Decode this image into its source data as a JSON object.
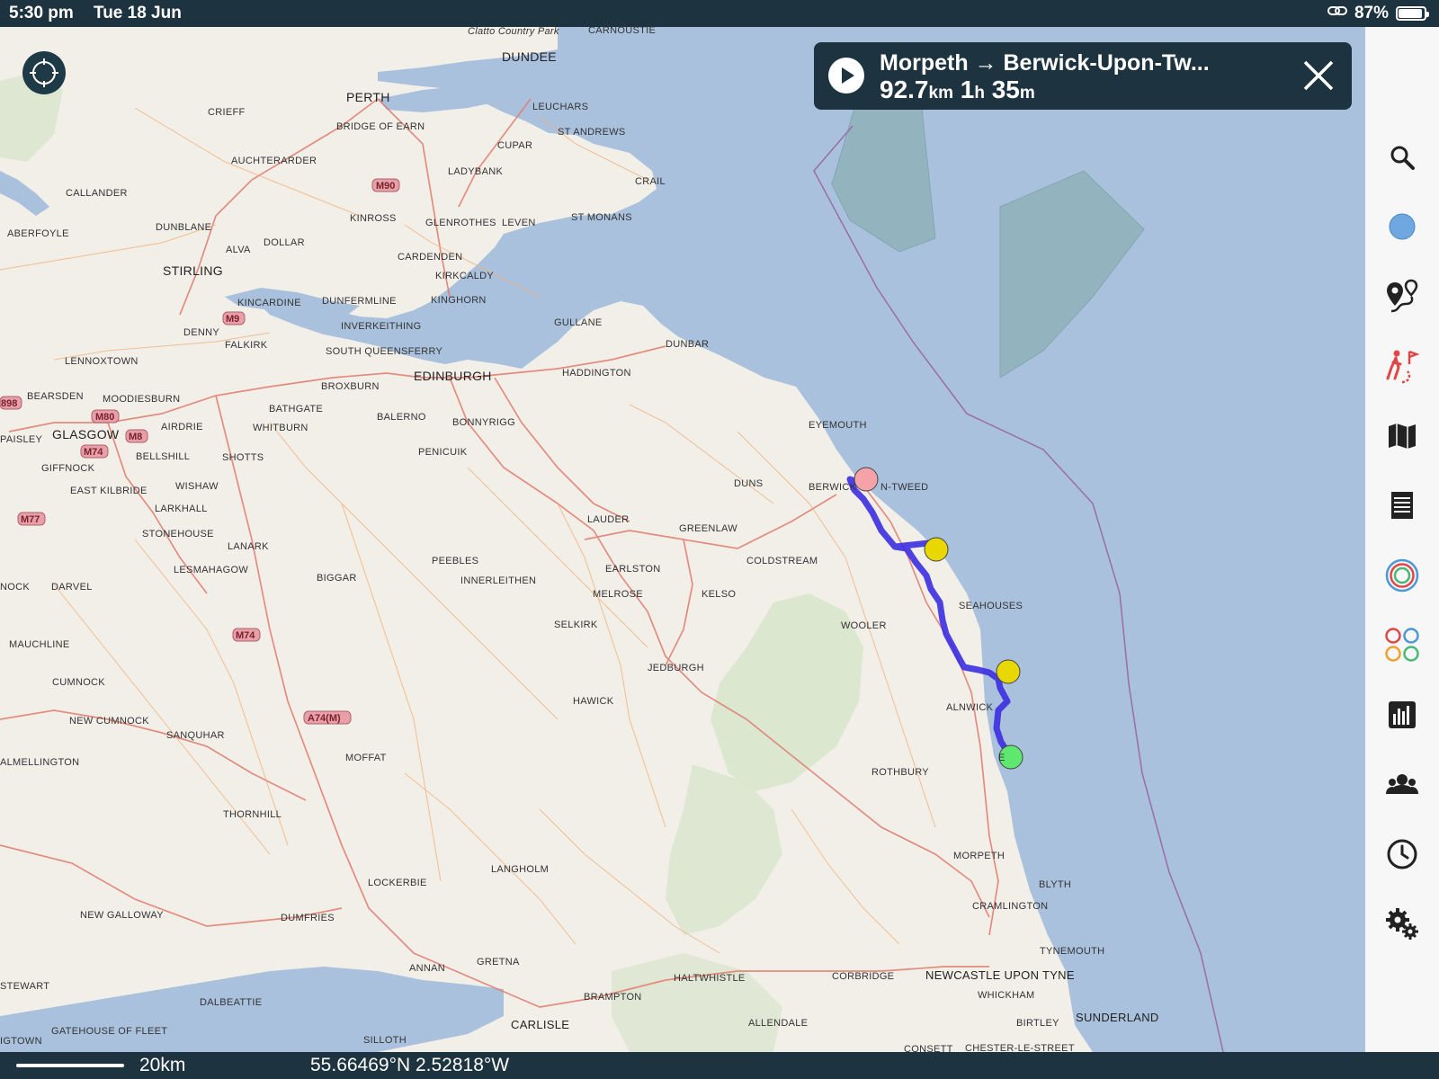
{
  "status_bar": {
    "time": "5:30 pm",
    "date": "Tue 18 Jun",
    "battery": "87%",
    "battery_level": 0.87
  },
  "route": {
    "title": "Morpeth → Berwick-Upon-Tw...",
    "distance_value": "92.7",
    "distance_unit": "km",
    "hours_value": "1",
    "hours_unit": "h",
    "minutes_value": "35",
    "minutes_unit": "m"
  },
  "map": {
    "places": [
      "DUNDEE",
      "PERTH",
      "CRIEFF",
      "BRIDGE OF EARN",
      "LEUCHARS",
      "ST ANDREWS",
      "CUPAR",
      "AUCHTERARDER",
      "LADYBANK",
      "CRAIL",
      "CALLANDER",
      "DUNBLANE",
      "KINROSS",
      "GLENROTHES",
      "LEVEN",
      "ST MONANS",
      "ABERFOYLE",
      "ALVA",
      "DOLLAR",
      "CARDENDEN",
      "STIRLING",
      "KIRKCALDY",
      "KINCARDINE",
      "DUNFERMLINE",
      "KINGHORN",
      "DENNY",
      "INVERKEITHING",
      "GULLANE",
      "FALKIRK",
      "DUNBAR",
      "LENNOXTOWN",
      "SOUTH QUEENSFERRY",
      "HADDINGTON",
      "BROXBURN",
      "EDINBURGH",
      "BEARSDEN",
      "MOODIESBURN",
      "BATHGATE",
      "GLASGOW",
      "AIRDRIE",
      "WHITBURN",
      "BALERNO",
      "BONNYRIGG",
      "PAISLEY",
      "BELLSHILL",
      "SHOTTS",
      "PENICUIK",
      "EYEMOUTH",
      "GIFFNOCK",
      "WISHAW",
      "EAST KILBRIDE",
      "DUNS",
      "LARKHALL",
      "LAUDER",
      "GREENLAW",
      "STONEHOUSE",
      "LANARK",
      "PEEBLES",
      "COLDSTREAM",
      "LESMAHAGOW",
      "INNERLEITHEN",
      "EARLSTON",
      "NOCK",
      "DARVEL",
      "BIGGAR",
      "MELROSE",
      "KELSO",
      "SEAHOUSES",
      "SELKIRK",
      "WOOLER",
      "MAUCHLINE",
      "JEDBURGH",
      "CUMNOCK",
      "HAWICK",
      "ALNWICK",
      "NEW CUMNOCK",
      "SANQUHAR",
      "MOFFAT",
      "ALMELLINGTON",
      "ROTHBURY",
      "THORNHILL",
      "MORPETH",
      "LANGHOLM",
      "LOCKERBIE",
      "BLYTH",
      "CRAMLINGTON",
      "NEW GALLOWAY",
      "DUMFRIES",
      "TYNEMOUTH",
      "STEWART",
      "ANNAN",
      "GRETNA",
      "HALTWHISTLE",
      "CORBRIDGE",
      "NEWCASTLE UPON TYNE",
      "DALBEATTIE",
      "BRAMPTON",
      "WHICKHAM",
      "GATEHOUSE OF FLEET",
      "CARLISLE",
      "ALLENDALE",
      "BIRTLEY",
      "SUNDERLAND",
      "IGTOWN",
      "SILLOTH",
      "CONSETT",
      "CHESTER-LE-STREET",
      "Clatto Country Park",
      "CARNOUSTIE"
    ],
    "berwick_label_left": "BERWICK",
    "berwick_label_right": "N-TWEED",
    "amble_label": "E",
    "road_shields": [
      "M90",
      "M9",
      "M80",
      "M8",
      "M74",
      "M77",
      "M74",
      "A74(M)",
      "898"
    ],
    "route_line_color": "#3b2ee0",
    "marker_colors": {
      "start": "#f5a3a8",
      "waypoint": "#e8d700",
      "end": "#5fe870"
    }
  },
  "sidebar": {
    "icons": [
      "search-icon",
      "location-dot-icon",
      "route-pins-icon",
      "hiking-track-icon",
      "map-layers-icon",
      "list-icon",
      "target-rings-icon",
      "circles-grid-icon",
      "chart-icon",
      "contacts-icon",
      "clock-icon",
      "settings-gears-icon"
    ]
  },
  "bottom_bar": {
    "scale": "20km",
    "coordinates": "55.66469°N 2.52818°W"
  }
}
